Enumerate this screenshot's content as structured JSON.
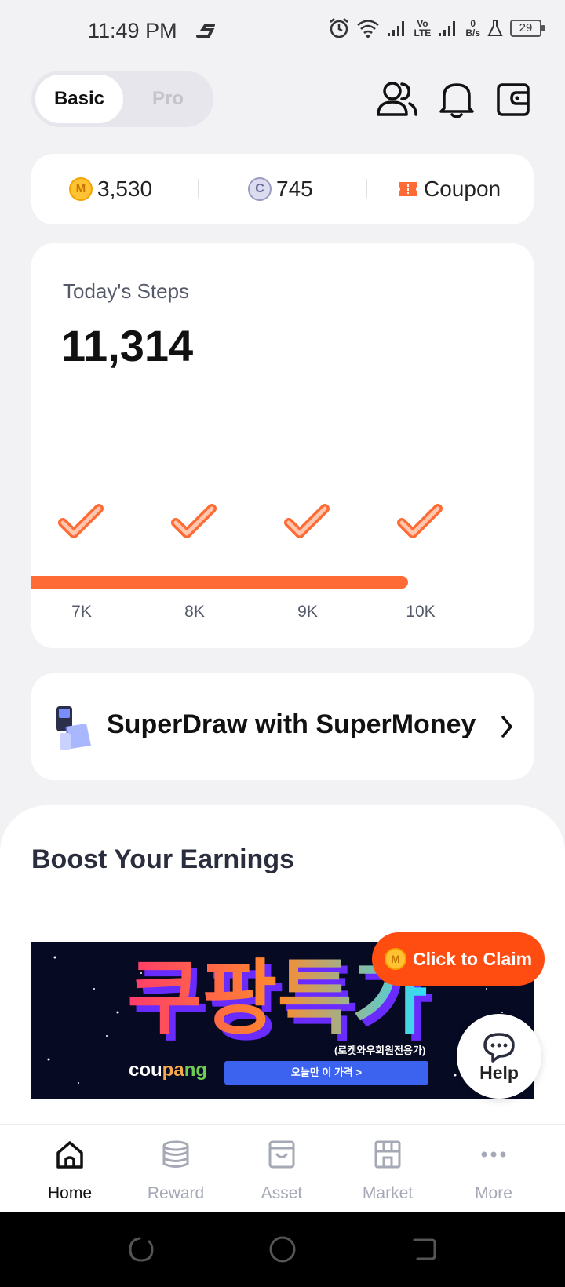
{
  "status_bar": {
    "time": "11:49 PM",
    "network_top": "0",
    "network_bottom": "B/s",
    "lte_top": "Vo",
    "lte_bottom": "LTE",
    "battery": "29"
  },
  "header": {
    "mode_basic": "Basic",
    "mode_pro": "Pro",
    "active_mode": "Basic"
  },
  "balance": {
    "coin_symbol": "M",
    "coin_amount": "3,530",
    "credit_symbol": "C",
    "credit_amount": "745",
    "coupon_label": "Coupon"
  },
  "steps": {
    "label": "Today's Steps",
    "value": "11,314",
    "progress_fraction": 0.75,
    "milestones": [
      "7K",
      "8K",
      "9K",
      "10K"
    ]
  },
  "promo": {
    "label": "SuperDraw with SuperMoney"
  },
  "boost": {
    "title": "Boost Your Earnings",
    "banner_title": "쿠팡특가",
    "banner_sub": "(로켓와우회원전용가)",
    "banner_logo_a": "cou",
    "banner_logo_b": "pa",
    "banner_logo_c": "ng",
    "banner_button": "오늘만 이 가격 >"
  },
  "claim": {
    "coin_symbol": "M",
    "label": "Click to Claim"
  },
  "help": {
    "label": "Help"
  },
  "nav": {
    "items": [
      {
        "label": "Home",
        "icon": "home-icon"
      },
      {
        "label": "Reward",
        "icon": "coins-icon"
      },
      {
        "label": "Asset",
        "icon": "bag-icon"
      },
      {
        "label": "Market",
        "icon": "store-icon"
      },
      {
        "label": "More",
        "icon": "more-icon"
      }
    ],
    "active": "Home"
  },
  "colors": {
    "accent": "#ff6b35",
    "claim": "#ff4d12",
    "background": "#f2f2f5",
    "card": "#ffffff"
  }
}
